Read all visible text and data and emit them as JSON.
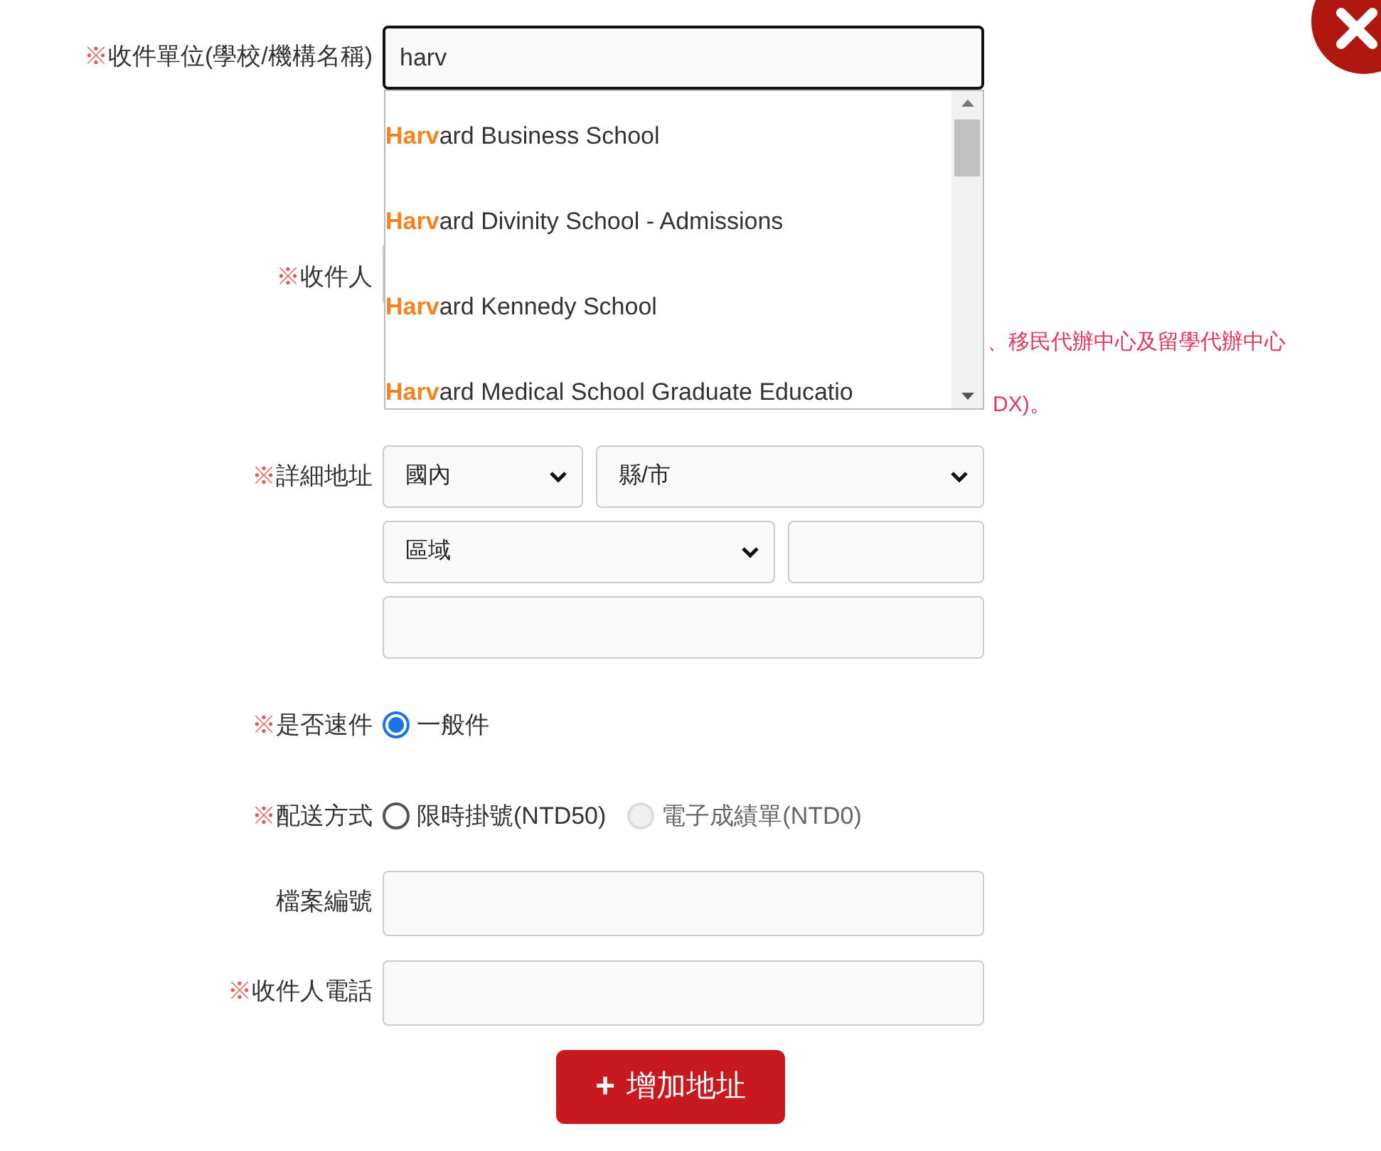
{
  "close_button": {
    "kind": "close"
  },
  "recipient_unit": {
    "mark": "※",
    "label": "收件單位(學校/機構名稱)",
    "value": "harv",
    "focused": true
  },
  "suggestions": [
    {
      "match": "Harv",
      "rest": "ard Business School"
    },
    {
      "match": "Harv",
      "rest": "ard Divinity School - Admissions"
    },
    {
      "match": "Harv",
      "rest": "ard Kennedy School"
    },
    {
      "match": "Harv",
      "rest": "ard Medical School Graduate Educatio"
    }
  ],
  "recipient": {
    "mark": "※",
    "label": "收件人"
  },
  "note_lines": [
    "、移民代辦中心及留學代辦中心",
    "DX)。"
  ],
  "address": {
    "mark": "※",
    "label": "詳細地址",
    "region": "國內",
    "city": "縣/市",
    "district": "區域"
  },
  "express": {
    "mark": "※",
    "label": "是否速件",
    "options": [
      {
        "label": "一般件",
        "selected": true,
        "disabled": false
      }
    ]
  },
  "delivery": {
    "mark": "※",
    "label": "配送方式",
    "options": [
      {
        "label": "限時掛號(NTD50)",
        "selected": false,
        "disabled": false
      },
      {
        "label": "電子成績單(NTD0)",
        "selected": false,
        "disabled": true
      }
    ]
  },
  "file_number": {
    "label": "檔案編號"
  },
  "phone": {
    "mark": "※",
    "label": "收件人電話"
  },
  "add_button": {
    "icon": "+",
    "label": "增加地址"
  }
}
